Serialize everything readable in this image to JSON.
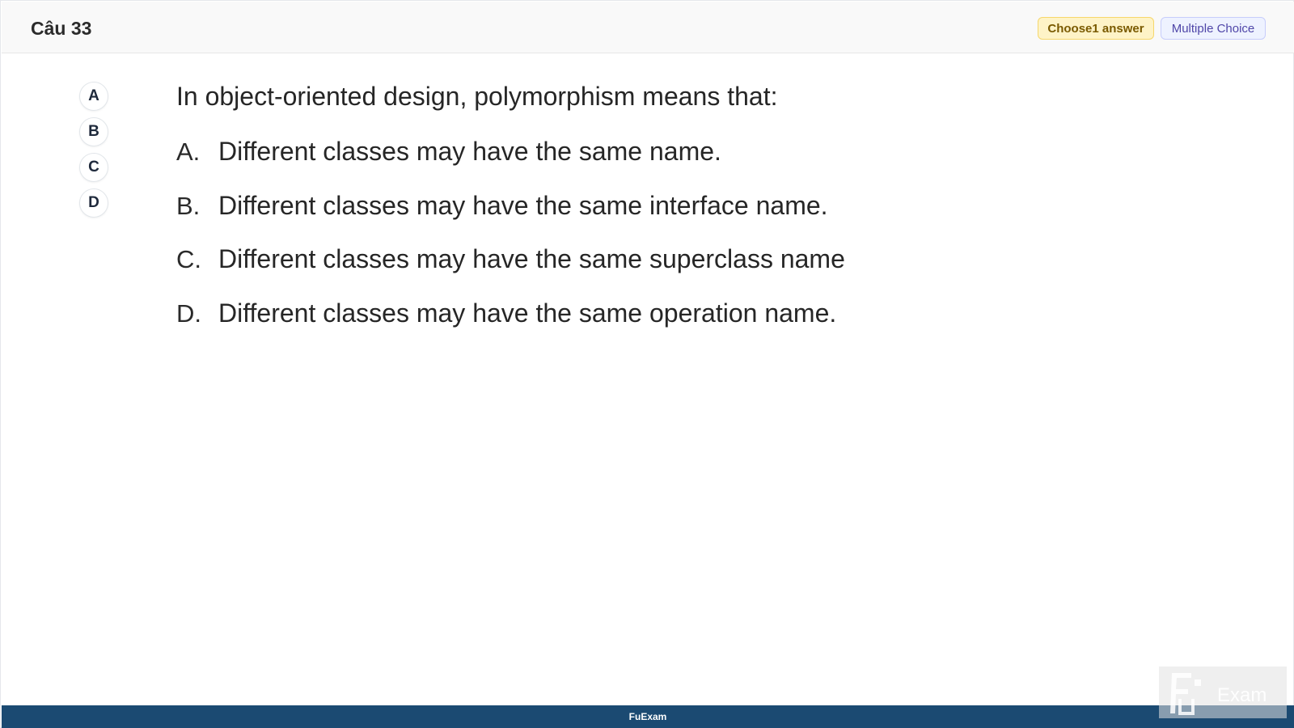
{
  "header": {
    "title": "Câu 33",
    "choose_badge": "Choose1 answer",
    "type_badge": "Multiple Choice"
  },
  "picker": {
    "options": [
      "A",
      "B",
      "C",
      "D"
    ]
  },
  "question": {
    "text": "In object-oriented design, polymorphism means that:",
    "answers": [
      {
        "letter": "A.",
        "text": "Different classes may have the same name."
      },
      {
        "letter": "B.",
        "text": "Different classes may have the same interface name."
      },
      {
        "letter": "C.",
        "text": "Different classes may have the same superclass name"
      },
      {
        "letter": "D.",
        "text": "Different classes may have the same operation name."
      }
    ]
  },
  "footer": {
    "label": "FuExam"
  },
  "watermark": {
    "text": "Exam"
  },
  "colors": {
    "footer_bg": "#1b4a72",
    "choose_badge_bg": "#fef3c7",
    "type_badge_bg": "#eef2ff"
  }
}
